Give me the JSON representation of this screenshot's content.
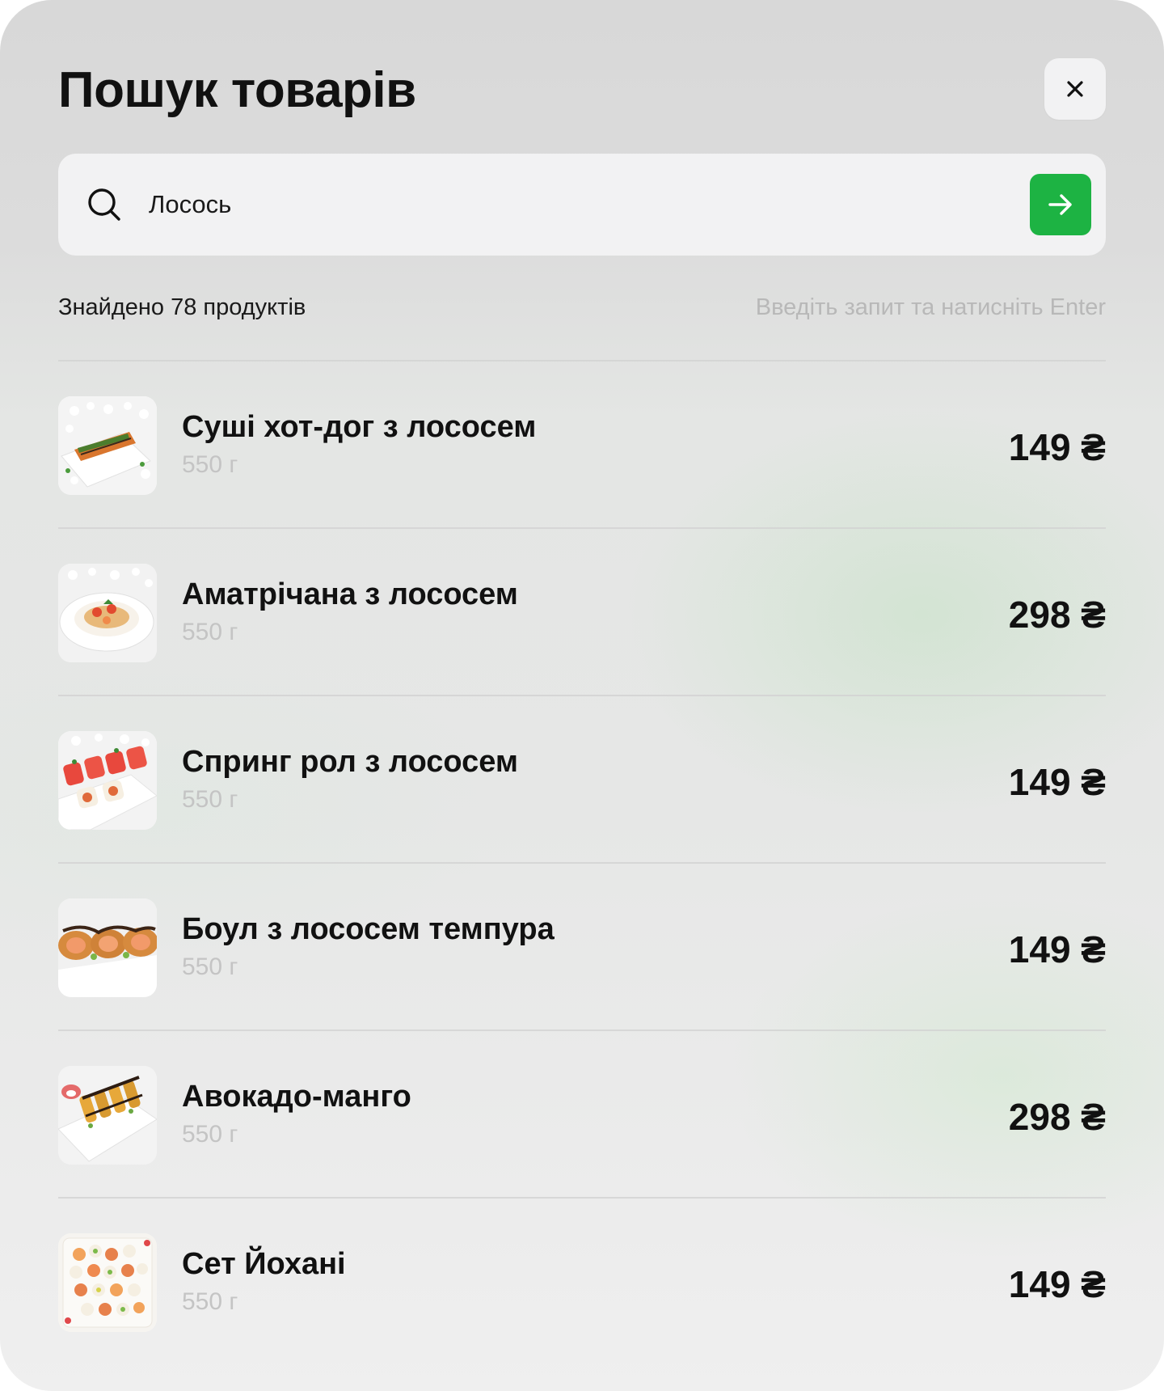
{
  "header": {
    "title": "Пошук товарів",
    "close_icon": "close-icon"
  },
  "search": {
    "value": "Лосось",
    "icon": "search-icon",
    "submit_icon": "arrow-right-icon",
    "submit_color": "#1db343"
  },
  "results": {
    "count_label": "Знайдено 78 продуктів",
    "hint": "Введіть запит та натисніть Enter",
    "items": [
      {
        "name": "Суші хот-дог з лососем",
        "weight": "550 г",
        "price": "149 ₴",
        "image": "sushi-hotdog-image"
      },
      {
        "name": "Аматрічана з лососем",
        "weight": "550 г",
        "price": "298 ₴",
        "image": "pasta-bowl-image"
      },
      {
        "name": "Спринг рол з лососем",
        "weight": "550 г",
        "price": "149 ₴",
        "image": "spring-roll-image"
      },
      {
        "name": "Боул з лососем темпура",
        "weight": "550 г",
        "price": "149 ₴",
        "image": "tempura-roll-image"
      },
      {
        "name": "Авокадо-манго",
        "weight": "550 г",
        "price": "298 ₴",
        "image": "avocado-mango-roll-image"
      },
      {
        "name": "Сет Йохані",
        "weight": "550 г",
        "price": "149 ₴",
        "image": "sushi-set-image"
      }
    ]
  }
}
